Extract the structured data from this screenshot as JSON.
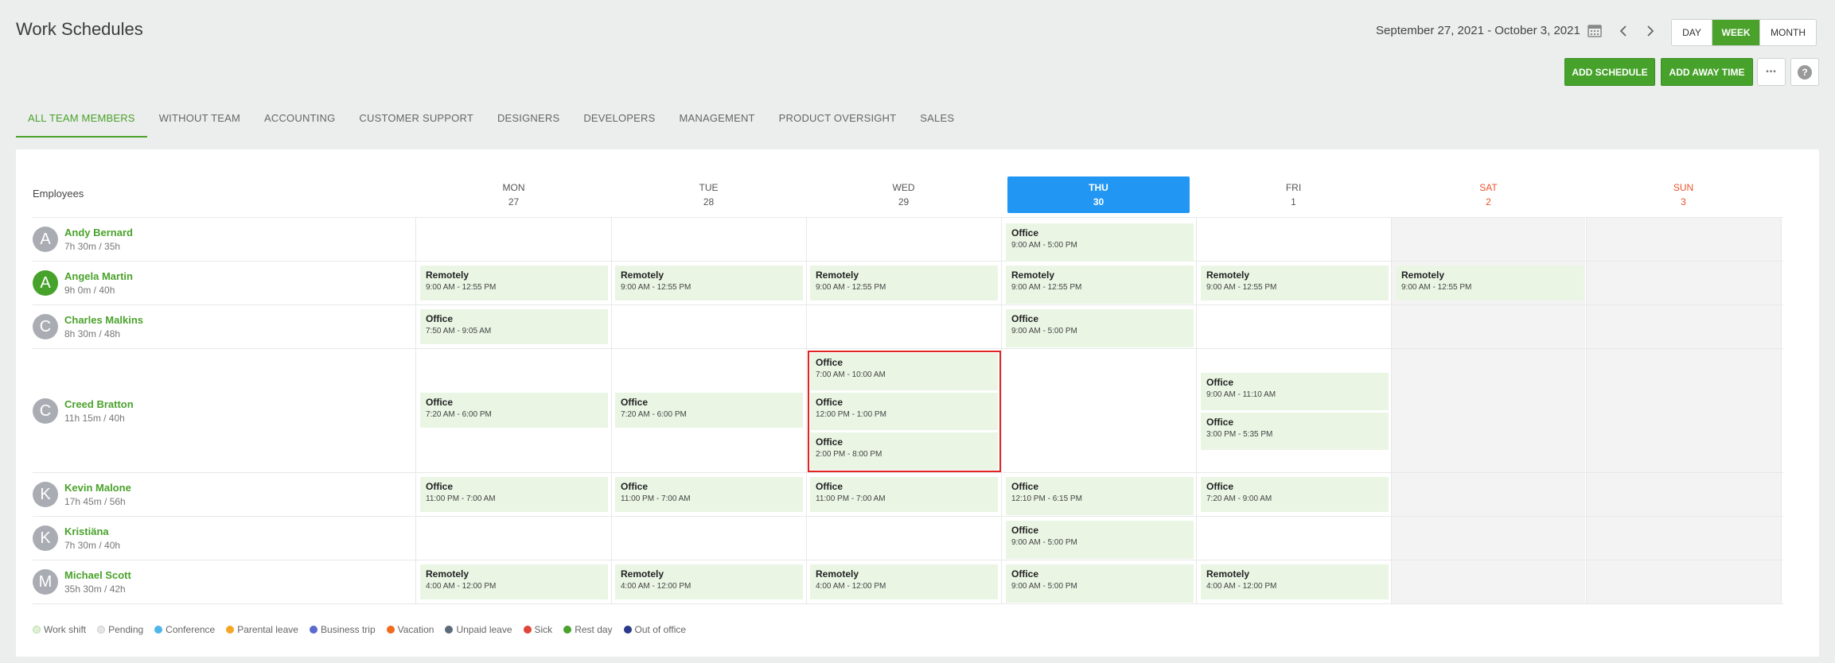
{
  "header": {
    "title": "Work Schedules",
    "date_range": "September 27, 2021 - October 3, 2021",
    "views": [
      "DAY",
      "WEEK",
      "MONTH"
    ],
    "active_view": "WEEK",
    "add_schedule": "ADD SCHEDULE",
    "add_away_time": "ADD AWAY TIME",
    "more_label": "•••",
    "help_label": "?"
  },
  "tabs": [
    "ALL TEAM MEMBERS",
    "WITHOUT TEAM",
    "ACCOUNTING",
    "CUSTOMER SUPPORT",
    "DESIGNERS",
    "DEVELOPERS",
    "MANAGEMENT",
    "PRODUCT OVERSIGHT",
    "SALES"
  ],
  "grid": {
    "employees_header": "Employees",
    "days": [
      {
        "name": "MON",
        "date": "27"
      },
      {
        "name": "TUE",
        "date": "28"
      },
      {
        "name": "WED",
        "date": "29"
      },
      {
        "name": "THU",
        "date": "30"
      },
      {
        "name": "FRI",
        "date": "1"
      },
      {
        "name": "SAT",
        "date": "2"
      },
      {
        "name": "SUN",
        "date": "3"
      }
    ]
  },
  "employees": [
    {
      "initial": "A",
      "name": "Andy Bernard",
      "hours": "7h 30m / 35h"
    },
    {
      "initial": "A",
      "name": "Angela Martin",
      "hours": "9h 0m / 40h"
    },
    {
      "initial": "C",
      "name": "Charles Malkins",
      "hours": "8h 30m / 48h"
    },
    {
      "initial": "C",
      "name": "Creed Bratton",
      "hours": "11h 15m / 40h"
    },
    {
      "initial": "K",
      "name": "Kevin Malone",
      "hours": "17h 45m / 56h"
    },
    {
      "initial": "K",
      "name": "Kristiäna",
      "hours": "7h 30m / 40h"
    },
    {
      "initial": "M",
      "name": "Michael Scott",
      "hours": "35h 30m / 42h"
    }
  ],
  "shift_types": {
    "office": "Office",
    "remote": "Remotely"
  },
  "times": {
    "t1": "9:00 AM - 5:00 PM",
    "t2": "9:00 AM - 12:55 PM",
    "t3": "7:50 AM - 9:05 AM",
    "t4": "7:20 AM - 6:00 PM",
    "t5": "7:00 AM - 10:00 AM",
    "t6": "12:00 PM - 1:00 PM",
    "t7": "2:00 PM - 8:00 PM",
    "t8": "9:00 AM - 11:10 AM",
    "t9": "3:00 PM - 5:35 PM",
    "t10": "11:00 PM - 7:00 AM",
    "t11": "12:10 PM - 6:15 PM",
    "t12": "7:20 AM - 9:00 AM",
    "t13": "4:00 AM - 12:00 PM"
  },
  "legend": [
    {
      "label": "Work shift",
      "color": "#dff0d4"
    },
    {
      "label": "Pending",
      "color": "#e6e6e6"
    },
    {
      "label": "Conference",
      "color": "#4fb6e9"
    },
    {
      "label": "Parental leave",
      "color": "#f5a623"
    },
    {
      "label": "Business trip",
      "color": "#5a6ad0"
    },
    {
      "label": "Vacation",
      "color": "#f26a1b"
    },
    {
      "label": "Unpaid leave",
      "color": "#5c6b7a"
    },
    {
      "label": "Sick",
      "color": "#e0453a"
    },
    {
      "label": "Rest day",
      "color": "#4aa22b"
    },
    {
      "label": "Out of office",
      "color": "#2b3a8a"
    }
  ],
  "colors": {
    "accent": "#4aa22b",
    "today": "#2196f3",
    "weekend": "#e8532c",
    "selection": "#e02424"
  }
}
